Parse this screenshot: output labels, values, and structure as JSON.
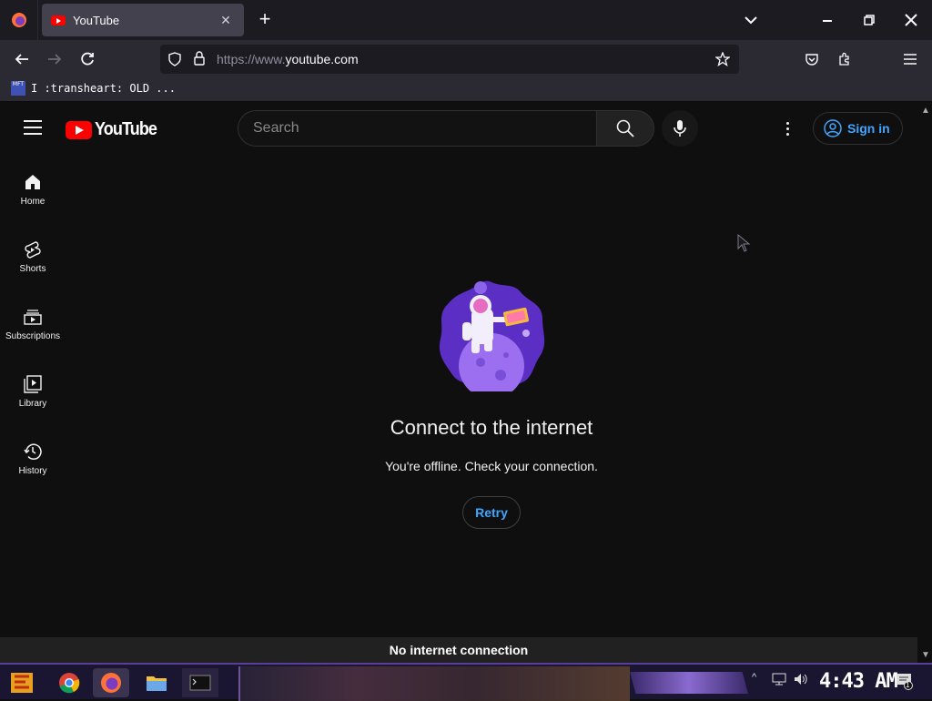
{
  "browser": {
    "tab_title": "YouTube",
    "url_prefix": "https://www.",
    "url_domain": "youtube.com",
    "bookmark_icon_text": "MFT",
    "bookmark_label": "I :transheart: OLD ..."
  },
  "youtube": {
    "logo_text": "YouTube",
    "search_placeholder": "Search",
    "sign_in_label": "Sign in",
    "guide": [
      {
        "label": "Home",
        "icon": "home-icon"
      },
      {
        "label": "Shorts",
        "icon": "shorts-icon"
      },
      {
        "label": "Subscriptions",
        "icon": "subscriptions-icon"
      },
      {
        "label": "Library",
        "icon": "library-icon"
      },
      {
        "label": "History",
        "icon": "history-icon"
      }
    ],
    "offline": {
      "title": "Connect to the internet",
      "message": "You're offline. Check your connection.",
      "retry_label": "Retry"
    },
    "status_message": "No internet connection"
  },
  "taskbar": {
    "clock": "4:43 AM",
    "notification_count": "1"
  },
  "colors": {
    "yt_red": "#ff0000",
    "link_blue": "#3ea6ff",
    "background": "#0f0f0f"
  }
}
